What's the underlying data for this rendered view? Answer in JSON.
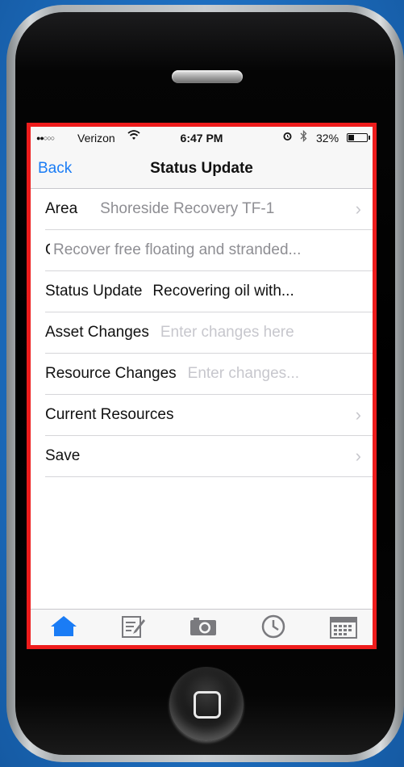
{
  "status_bar": {
    "signal": "●●○○○",
    "carrier": "Verizon",
    "time": "6:47 PM",
    "battery_percent": "32%",
    "battery_level": 0.32,
    "wifi_icon": "wifi-icon",
    "alarm_icon": "alarm-icon",
    "bluetooth_icon": "bluetooth-icon"
  },
  "nav": {
    "back_label": "Back",
    "title": "Status Update"
  },
  "rows": {
    "area": {
      "label": "Area",
      "value": "Shoreside Recovery TF-1"
    },
    "objective": {
      "label": "O",
      "value": "Recover free floating and stranded..."
    },
    "status_update": {
      "label": "Status Update",
      "value": "Recovering oil with..."
    },
    "asset_changes": {
      "label": "Asset Changes",
      "placeholder": "Enter changes here"
    },
    "resource_changes": {
      "label": "Resource Changes",
      "placeholder": "Enter changes..."
    },
    "current_resources": {
      "label": "Current Resources"
    },
    "save": {
      "label": "Save"
    }
  },
  "tabs": [
    {
      "icon": "home-icon",
      "active": true
    },
    {
      "icon": "compose-icon",
      "active": false
    },
    {
      "icon": "camera-icon",
      "active": false
    },
    {
      "icon": "clock-icon",
      "active": false
    },
    {
      "icon": "calendar-icon",
      "active": false
    }
  ],
  "colors": {
    "accent": "#1a7cf5",
    "highlight_border": "#ee1c1c",
    "background": "#1e6fc1"
  }
}
